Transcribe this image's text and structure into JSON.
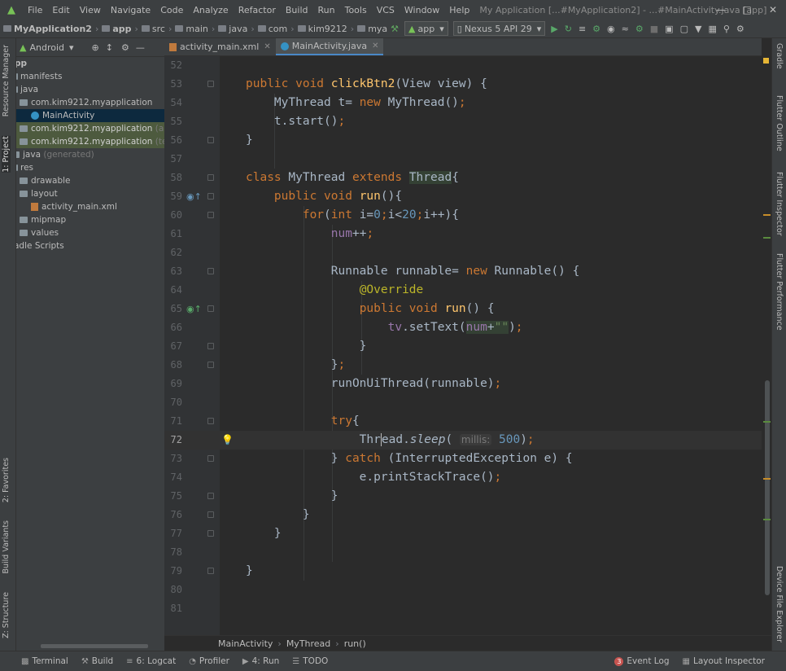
{
  "menu": {
    "items": [
      "File",
      "Edit",
      "View",
      "Navigate",
      "Code",
      "Analyze",
      "Refactor",
      "Build",
      "Run",
      "Tools",
      "VCS",
      "Window",
      "Help"
    ],
    "window_title": "My Application [...#MyApplication2] - ...#MainActivity.java [app]"
  },
  "nav": {
    "crumbs": [
      "MyApplication2",
      "app",
      "src",
      "main",
      "java",
      "com",
      "kim9212",
      "mya"
    ],
    "run_config": "app",
    "device": "Nexus 5 API 29"
  },
  "project": {
    "view": "Android",
    "rows": [
      {
        "text": "pp",
        "extra": ""
      },
      {
        "text": "manifests",
        "extra": ""
      },
      {
        "text": "java",
        "extra": ""
      },
      {
        "text": "com.kim9212.myapplication",
        "extra": ""
      },
      {
        "text": "MainActivity",
        "extra": ""
      },
      {
        "text": "com.kim9212.myapplication",
        "extra": "(android"
      },
      {
        "text": "com.kim9212.myapplication",
        "extra": "(test)"
      },
      {
        "text": "java",
        "extra": "(generated)"
      },
      {
        "text": "res",
        "extra": ""
      },
      {
        "text": "drawable",
        "extra": ""
      },
      {
        "text": "layout",
        "extra": ""
      },
      {
        "text": "activity_main.xml",
        "extra": ""
      },
      {
        "text": "mipmap",
        "extra": ""
      },
      {
        "text": "values",
        "extra": ""
      },
      {
        "text": "adle Scripts",
        "extra": ""
      }
    ]
  },
  "left_stripe": [
    "Resource Manager",
    "1: Project",
    "2: Favorites",
    "Build Variants",
    "Z: Structure"
  ],
  "right_stripe": [
    "Gradle",
    "Flutter Outline",
    "Flutter Inspector",
    "Flutter Performance",
    "Device File Explorer"
  ],
  "tabs": [
    {
      "label": "activity_main.xml"
    },
    {
      "label": "MainActivity.java"
    }
  ],
  "editor": {
    "line_numbers": [
      "52",
      "53",
      "54",
      "55",
      "56",
      "57",
      "58",
      "59",
      "60",
      "61",
      "62",
      "63",
      "64",
      "65",
      "66",
      "67",
      "68",
      "69",
      "70",
      "71",
      "72",
      "73",
      "74",
      "75",
      "76",
      "77",
      "78",
      "79",
      "80",
      "81"
    ],
    "current_line": "72",
    "param_hint": "millis:"
  },
  "breadcrumb": [
    "MainActivity",
    "MyThread",
    "run()"
  ],
  "bottom_tools": {
    "terminal": "Terminal",
    "build": "Build",
    "logcat": "6: Logcat",
    "profiler": "Profiler",
    "run": "4: Run",
    "todo": "TODO",
    "event_log": "Event Log",
    "event_count": "3",
    "layout_inspector": "Layout Inspector"
  },
  "colors": {
    "keyword": "#cc7832",
    "function": "#ffc66d",
    "number": "#6897bb",
    "annotation": "#bbb529",
    "field": "#9876aa",
    "string": "#6a8759"
  }
}
